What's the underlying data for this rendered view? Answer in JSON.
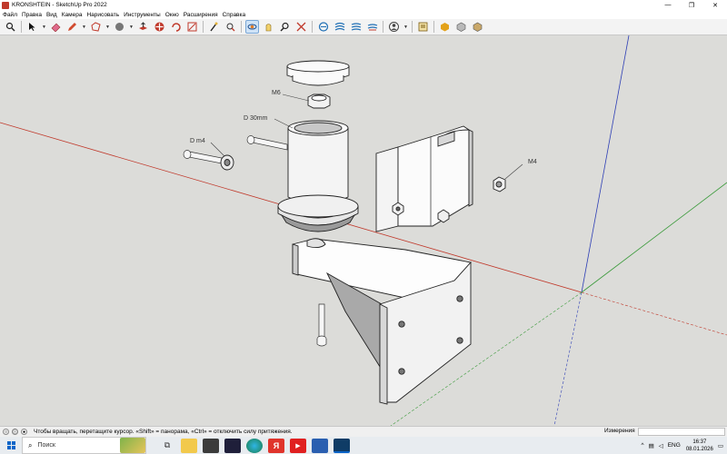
{
  "window": {
    "title": "KRONSHTEIN - SketchUp Pro 2022",
    "minimize": "—",
    "maximize": "❐",
    "close": "✕"
  },
  "menu": [
    "Файл",
    "Правка",
    "Вид",
    "Камера",
    "Нарисовать",
    "Инструменты",
    "Окно",
    "Расширения",
    "Справка"
  ],
  "toolbar": {
    "active_tool": "orbit",
    "tools": [
      "search-icon",
      "select-icon",
      "eraser-icon",
      "pencil-icon",
      "shape-icon",
      "paint-icon",
      "push-pull-icon",
      "move-icon",
      "rotate-icon",
      "scale-icon",
      "tape-icon",
      "text-icon",
      "orbit-icon",
      "pan-icon",
      "zoom-icon",
      "zoom-extents-icon",
      "section-icon",
      "layers-icon",
      "styles-icon",
      "account-icon",
      "warehouse-icon",
      "extension-icon",
      "components-icon",
      "materials-icon"
    ]
  },
  "model_labels": {
    "cap_nut": "M6",
    "tube": "D 30mm",
    "washer": "D m4",
    "nut": "M4"
  },
  "status": {
    "hint": "Чтобы вращать, перетащите курсор. «Shift» = панорама, «Ctrl» = отключить силу притяжения.",
    "measurements_label": "Измерения",
    "measurements_value": ""
  },
  "taskbar": {
    "search_placeholder": "Поиск",
    "lang": "ENG",
    "time": "16:37",
    "date": "08.01.2026"
  },
  "colors": {
    "viewport_bg": "#dcdcd9",
    "axis_red": "#c0392b",
    "axis_green": "#3a9a3a",
    "axis_blue": "#2e3fb5",
    "accent": "#0a64c8"
  }
}
